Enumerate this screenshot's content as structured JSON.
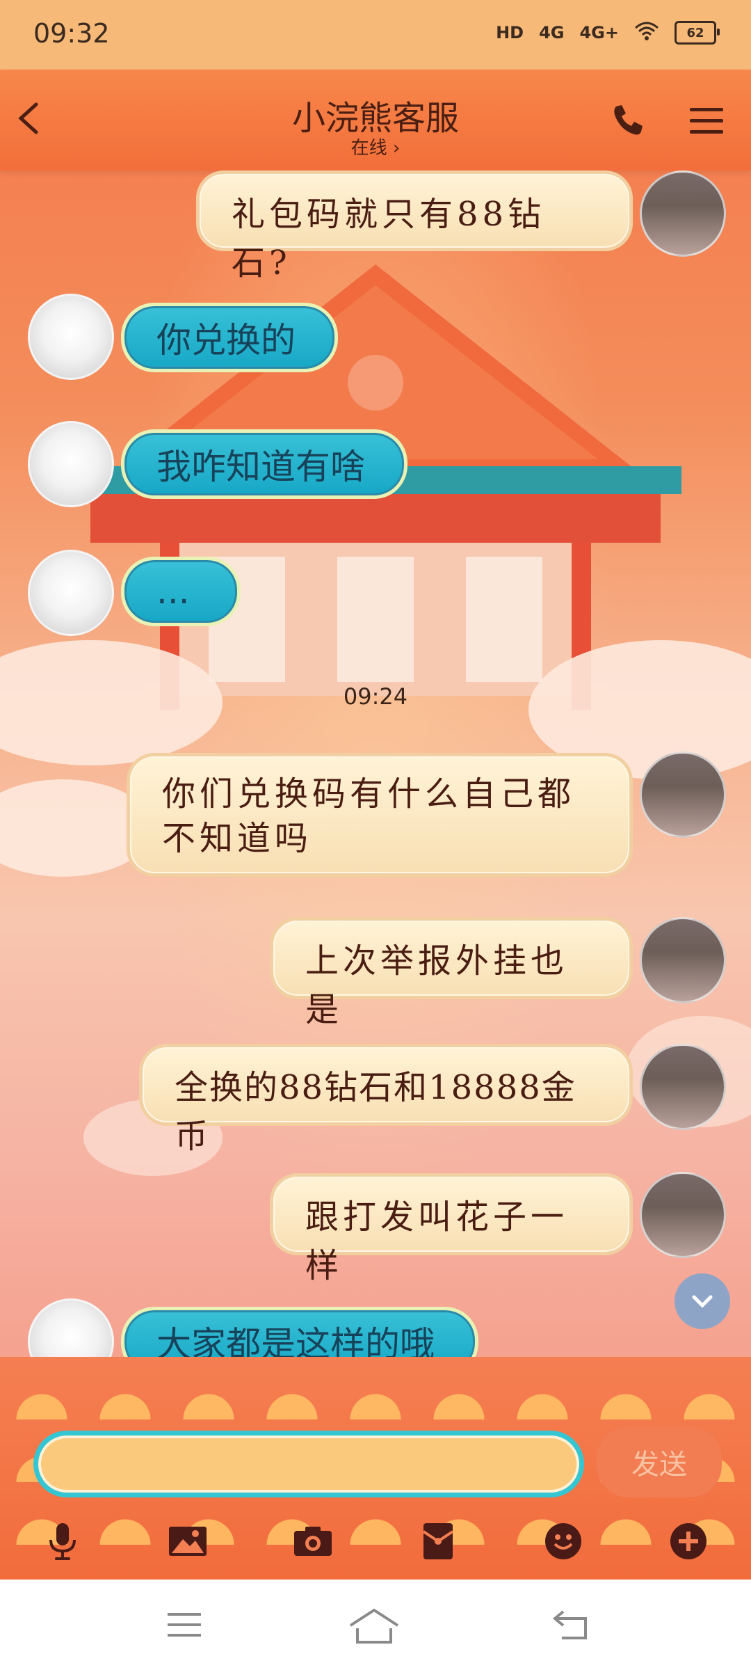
{
  "status_bar": {
    "time": "09:32",
    "hd": "HD",
    "sig1": "4G",
    "sig2": "4G+",
    "battery": "62"
  },
  "header": {
    "title": "小浣熊客服",
    "subtitle": "在线 ›"
  },
  "messages": [
    {
      "side": "right",
      "text": "礼包码就只有88钻石?"
    },
    {
      "side": "left",
      "text": "你兑换的"
    },
    {
      "side": "left",
      "text": "我咋知道有啥"
    },
    {
      "side": "left",
      "text": "..."
    },
    {
      "side": "right",
      "text": "你们兑换码有什么自己都不知道吗"
    },
    {
      "side": "right",
      "text": "上次举报外挂也是"
    },
    {
      "side": "right",
      "text": "全换的88钻石和18888金币"
    },
    {
      "side": "right",
      "text": "跟打发叫花子一样"
    },
    {
      "side": "left",
      "text": "大家都是这样的哦"
    }
  ],
  "timestamp": "09:24",
  "composer": {
    "input_value": "",
    "send_label": "发送"
  },
  "toolbar_icons": [
    "microphone-icon",
    "image-icon",
    "camera-icon",
    "red-envelope-icon",
    "emoji-icon",
    "plus-icon"
  ],
  "colors": {
    "accent_cyan": "#35c6d3",
    "header": "#f36e3a",
    "bubble_right": "#fff3d6"
  }
}
